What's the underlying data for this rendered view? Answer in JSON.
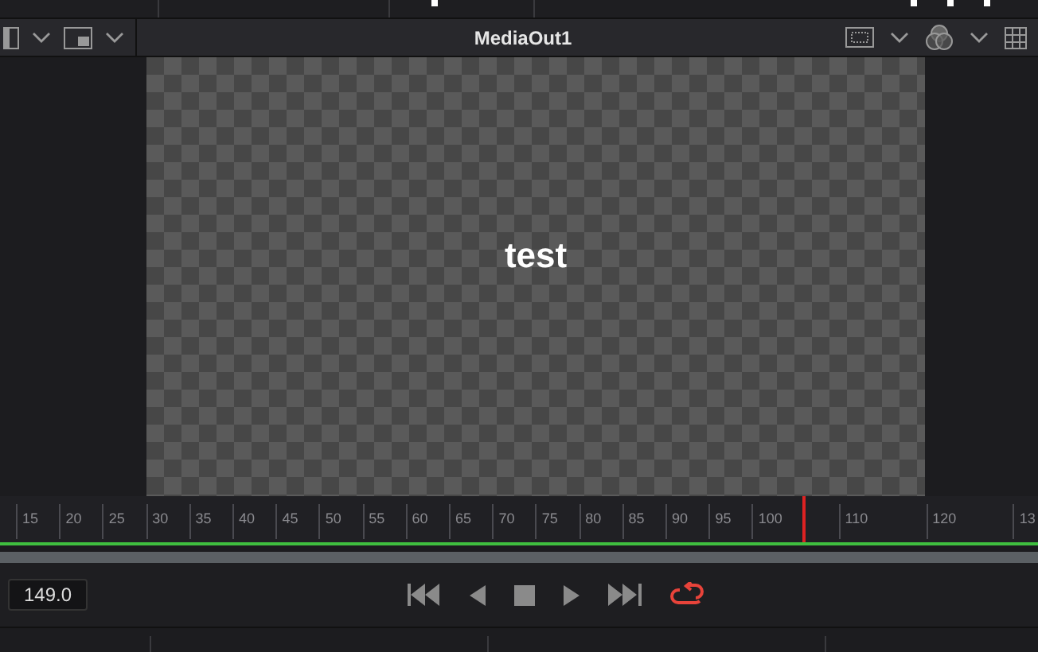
{
  "viewer": {
    "title": "MediaOut1",
    "overlay_text": "test"
  },
  "ruler": {
    "labels": [
      "15",
      "20",
      "25",
      "30",
      "35",
      "40",
      "45",
      "50",
      "55",
      "60",
      "65",
      "70",
      "75",
      "80",
      "85",
      "90",
      "95",
      "100",
      "110",
      "120",
      "13"
    ],
    "level": 0.773
  },
  "transport": {
    "frame": "149.0",
    "loop": true
  }
}
